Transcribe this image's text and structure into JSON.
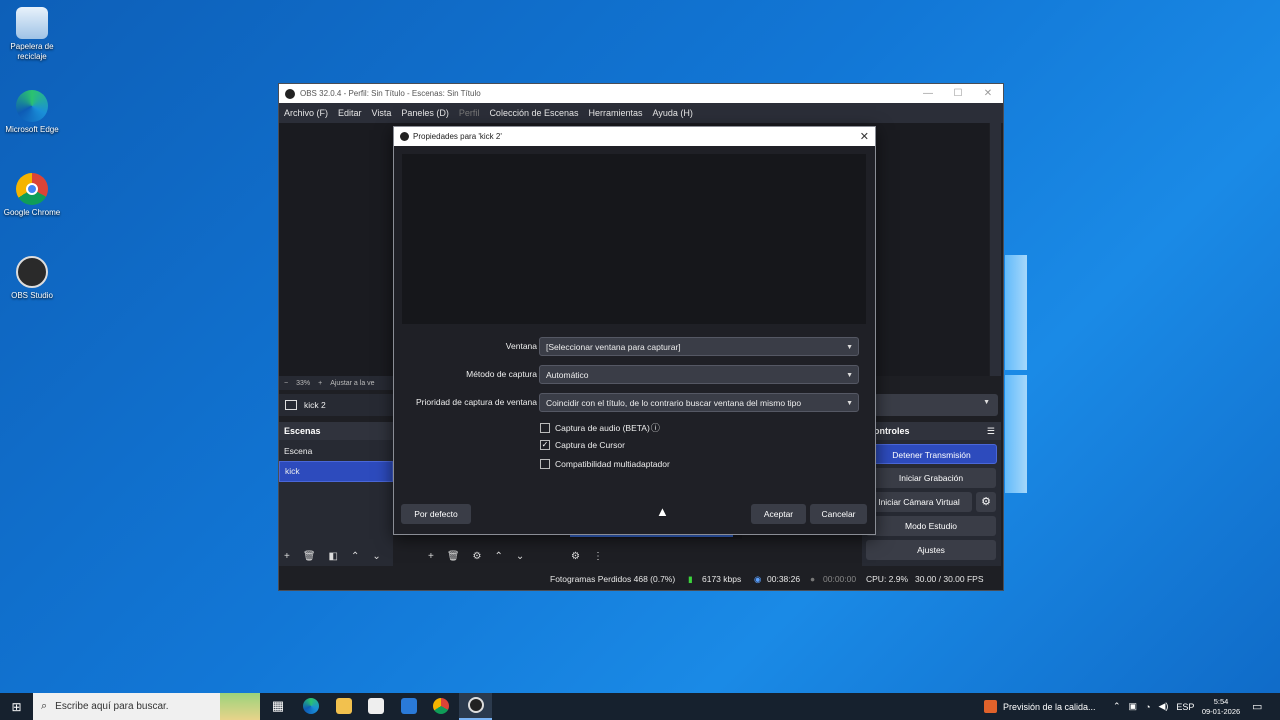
{
  "desktop": {
    "icons": [
      {
        "label": "Papelera de reciclaje"
      },
      {
        "label": "Microsoft Edge"
      },
      {
        "label": "Google Chrome"
      },
      {
        "label": "OBS Studio"
      }
    ]
  },
  "obs": {
    "title": "OBS 32.0.4 - Perfil: Sin Título - Escenas: Sin Título",
    "menu": [
      "Archivo (F)",
      "Editar",
      "Vista",
      "Paneles (D)",
      "Perfil",
      "Colección de Escenas",
      "Herramientas",
      "Ayuda (H)"
    ],
    "zoom": {
      "minus": "−",
      "value": "33%",
      "plus": "+",
      "fit": "Ajustar a la ve"
    },
    "source_bar": {
      "name": "kick 2"
    },
    "scenes": {
      "header": "Escenas",
      "items": [
        "Escena",
        "kick"
      ]
    },
    "controls": {
      "header": "ontroles",
      "buttons": [
        "Detener Transmisión",
        "Iniciar Grabación",
        "Iniciar Cámara Virtual",
        "Modo Estudio",
        "Ajustes"
      ]
    },
    "status": {
      "dropped": "Fotogramas Perdidos 468 (0.7%)",
      "kbps": "6173 kbps",
      "stream_time": "00:38:26",
      "rec_time": "00:00:00",
      "cpu": "CPU: 2.9%",
      "fps": "30.00 / 30.00 FPS"
    }
  },
  "dialog": {
    "title": "Propiedades para 'kick 2'",
    "fields": [
      {
        "label": "Ventana",
        "value": "[Seleccionar ventana para capturar]"
      },
      {
        "label": "Método de captura",
        "value": "Automático"
      },
      {
        "label": "Prioridad de captura de ventana",
        "value": "Coincidir con el título, de lo contrario buscar ventana del mismo tipo"
      }
    ],
    "checkboxes": [
      {
        "label": "Captura de audio (BETA)",
        "checked": false
      },
      {
        "label": "Captura de Cursor",
        "checked": true
      },
      {
        "label": "Compatibilidad multiadaptador",
        "checked": false
      }
    ],
    "defaults_button": "Por defecto",
    "ok_button": "Aceptar",
    "cancel_button": "Cancelar"
  },
  "taskbar": {
    "search_placeholder": "Escribe aquí para buscar.",
    "news": "Previsión de la calida...",
    "lang": "ESP",
    "time": "5:54",
    "date": "09-01-2026"
  }
}
